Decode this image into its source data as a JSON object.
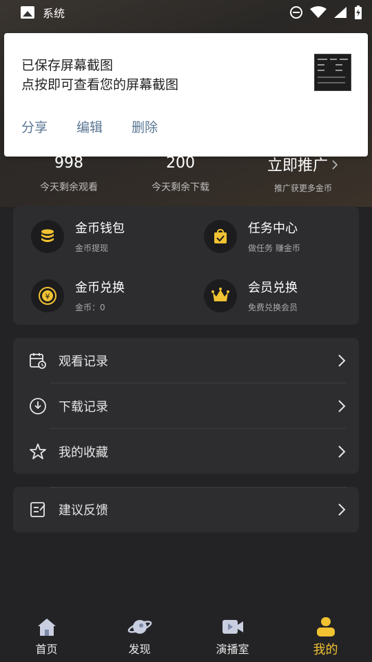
{
  "status_bar": {
    "app_name": "系统"
  },
  "notification": {
    "title": "已保存屏幕截图",
    "message": "点按即可查看您的屏幕截图",
    "actions": [
      "分享",
      "编辑",
      "删除"
    ]
  },
  "stats": [
    {
      "value": "998",
      "label": "今天剩余观看"
    },
    {
      "value": "200",
      "label": "今天剩余下载"
    },
    {
      "value": "立即推广",
      "label": "推广获更多金币"
    }
  ],
  "grid": [
    {
      "title": "金币钱包",
      "sub": "金币提现",
      "icon": "coin-stack-icon"
    },
    {
      "title": "任务中心",
      "sub": "做任务 赚金币",
      "icon": "task-bag-icon"
    },
    {
      "title": "金币兑换",
      "sub": "金币：0",
      "icon": "yuan-exchange-icon"
    },
    {
      "title": "会员兑换",
      "sub": "免费兑换会员",
      "icon": "crown-icon"
    }
  ],
  "list_rows": [
    {
      "label": "观看记录",
      "icon": "calendar-clock-icon"
    },
    {
      "label": "下载记录",
      "icon": "download-icon"
    },
    {
      "label": "我的收藏",
      "icon": "star-icon"
    }
  ],
  "feedback": {
    "label": "建议反馈",
    "icon": "feedback-icon"
  },
  "bottom_nav": [
    {
      "label": "首页",
      "icon": "home-icon"
    },
    {
      "label": "发现",
      "icon": "planet-icon"
    },
    {
      "label": "演播室",
      "icon": "video-icon"
    },
    {
      "label": "我的",
      "icon": "user-icon",
      "active": true
    }
  ],
  "colors": {
    "accent": "#f1c232",
    "card": "#2d2d30",
    "background": "#232325"
  }
}
